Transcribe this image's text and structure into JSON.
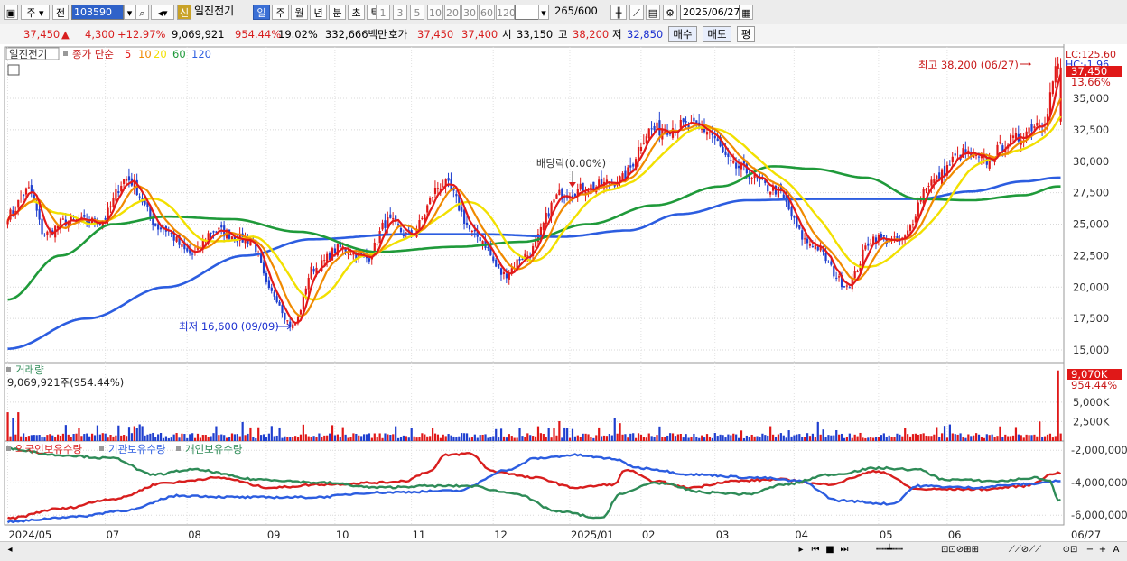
{
  "toolbar": {
    "type_label": "주",
    "market_label": "전",
    "stock_code": "103590",
    "new_badge": "신",
    "stock_name": "일진전기",
    "periods": [
      "일",
      "주",
      "월",
      "년",
      "분",
      "초",
      "틱"
    ],
    "selected_period": "일",
    "intervals": [
      "1",
      "3",
      "5",
      "10",
      "20",
      "30",
      "60",
      "120"
    ],
    "count": "265",
    "count_total": "/600",
    "date": "2025/06/27"
  },
  "info": {
    "price": "37,450",
    "change": "4,300",
    "change_pct": "+12.97%",
    "volume": "9,069,921",
    "volume_ratio": "954.44%",
    "turnover": "19.02%",
    "amount": "332,666백만",
    "ask_label": "호가",
    "ask": "37,450",
    "bid": "37,400",
    "open_label": "시",
    "open": "33,150",
    "high_label": "고",
    "high": "38,200",
    "low_label": "저",
    "low": "32,850",
    "buy_label": "매수",
    "sell_label": "매도",
    "eval_label": "평"
  },
  "legend": {
    "name": "일진전기",
    "ma_text": "종가 단순",
    "ma_periods": [
      "5",
      "10",
      "20",
      "60",
      "120"
    ],
    "ma_colors": [
      "#e31a1a",
      "#f08a00",
      "#f2e000",
      "#1f9a3a",
      "#2c5de0"
    ],
    "volume_label": "거래량",
    "volume_value": "9,069,921주(954.44%)",
    "holdings": [
      "외국인보유수량",
      "기관보유수량",
      "개인보유수량"
    ],
    "holdings_colors": [
      "#d81e1e",
      "#2c5de0",
      "#2e8b57"
    ]
  },
  "annotations": {
    "high_note": "최고 38,200 (06/27)",
    "low_note": "최저 16,600 (09/09)",
    "dividend_note": "배당락(0.00%)",
    "lc": "LC:125.60",
    "hc": "HC:-1.96",
    "price_tag": "37,450",
    "pct_tag": "13.66%",
    "vol_tag": "9,070K",
    "vol_pct_tag": "954.44%"
  },
  "chart_data": {
    "type": "line",
    "price_axis": {
      "ticks": [
        "35,000",
        "32,500",
        "30,000",
        "27,500",
        "25,000",
        "22,500",
        "20,000",
        "17,500",
        "15,000"
      ],
      "ylim": [
        14000,
        38800
      ]
    },
    "volume_axis": {
      "ticks": [
        "5,000K",
        "2,500K"
      ],
      "ylim": [
        0,
        9500
      ]
    },
    "holding_axis": {
      "ticks": [
        "-2,000,000",
        "-4,000,000",
        "-6,000,000"
      ],
      "ylim": [
        -6600000,
        -1600000
      ]
    },
    "x_labels": [
      "2024/05",
      "07",
      "08",
      "09",
      "10",
      "11",
      "12",
      "2025/01",
      "02",
      "03",
      "04",
      "05",
      "06",
      "06/27"
    ],
    "x_label_positions": [
      0,
      37,
      68,
      98,
      124,
      153,
      184,
      213,
      240,
      268,
      298,
      330,
      356,
      392
    ],
    "n": 400,
    "close_key": [
      [
        0,
        25700
      ],
      [
        8,
        27700
      ],
      [
        14,
        24200
      ],
      [
        22,
        25200
      ],
      [
        35,
        25200
      ],
      [
        45,
        28600
      ],
      [
        58,
        24700
      ],
      [
        70,
        22600
      ],
      [
        78,
        24500
      ],
      [
        92,
        23700
      ],
      [
        100,
        19500
      ],
      [
        108,
        16900
      ],
      [
        116,
        21500
      ],
      [
        126,
        23100
      ],
      [
        136,
        22300
      ],
      [
        144,
        25200
      ],
      [
        152,
        24100
      ],
      [
        165,
        28200
      ],
      [
        178,
        24000
      ],
      [
        188,
        21000
      ],
      [
        196,
        22500
      ],
      [
        210,
        27400
      ],
      [
        222,
        28000
      ],
      [
        232,
        28500
      ],
      [
        244,
        32500
      ],
      [
        256,
        32800
      ],
      [
        264,
        32500
      ],
      [
        276,
        29500
      ],
      [
        290,
        27800
      ],
      [
        304,
        23500
      ],
      [
        318,
        20200
      ],
      [
        328,
        23900
      ],
      [
        338,
        23600
      ],
      [
        350,
        28400
      ],
      [
        362,
        30600
      ],
      [
        370,
        30000
      ],
      [
        380,
        31600
      ],
      [
        392,
        33200
      ],
      [
        398,
        37450
      ]
    ],
    "ma60_key": [
      [
        0,
        19000
      ],
      [
        20,
        22500
      ],
      [
        40,
        25000
      ],
      [
        60,
        25600
      ],
      [
        85,
        25400
      ],
      [
        110,
        24400
      ],
      [
        140,
        22800
      ],
      [
        170,
        23200
      ],
      [
        195,
        23600
      ],
      [
        220,
        25000
      ],
      [
        245,
        26500
      ],
      [
        270,
        28000
      ],
      [
        290,
        29600
      ],
      [
        305,
        29400
      ],
      [
        325,
        28700
      ],
      [
        345,
        27000
      ],
      [
        365,
        26900
      ],
      [
        385,
        27300
      ],
      [
        398,
        28000
      ]
    ],
    "ma120_key": [
      [
        0,
        15100
      ],
      [
        30,
        17500
      ],
      [
        60,
        20000
      ],
      [
        90,
        22500
      ],
      [
        115,
        23800
      ],
      [
        150,
        24200
      ],
      [
        180,
        24200
      ],
      [
        210,
        24000
      ],
      [
        235,
        24500
      ],
      [
        255,
        25800
      ],
      [
        280,
        26900
      ],
      [
        305,
        27000
      ],
      [
        325,
        27000
      ],
      [
        345,
        27000
      ],
      [
        365,
        27600
      ],
      [
        385,
        28400
      ],
      [
        398,
        28700
      ]
    ],
    "dividend_index": 214,
    "volume_spikes": [
      [
        0,
        3700
      ],
      [
        2,
        3000
      ],
      [
        4,
        3700
      ],
      [
        42,
        2000
      ],
      [
        147,
        1900
      ],
      [
        205,
        1700
      ],
      [
        230,
        2900
      ],
      [
        232,
        2300
      ],
      [
        340,
        1700
      ],
      [
        352,
        1800
      ],
      [
        382,
        1800
      ],
      [
        398,
        9070
      ]
    ],
    "foreign_key": [
      [
        0,
        -6200000
      ],
      [
        20,
        -5600000
      ],
      [
        40,
        -5000000
      ],
      [
        60,
        -4000000
      ],
      [
        80,
        -3700000
      ],
      [
        100,
        -4300000
      ],
      [
        120,
        -4100000
      ],
      [
        140,
        -4000000
      ],
      [
        150,
        -3900000
      ],
      [
        160,
        -3300000
      ],
      [
        166,
        -2300000
      ],
      [
        175,
        -2200000
      ],
      [
        184,
        -3300000
      ],
      [
        200,
        -3700000
      ],
      [
        215,
        -4300000
      ],
      [
        230,
        -4100000
      ],
      [
        234,
        -3200000
      ],
      [
        245,
        -3900000
      ],
      [
        258,
        -4300000
      ],
      [
        275,
        -3900000
      ],
      [
        292,
        -3800000
      ],
      [
        310,
        -4100000
      ],
      [
        330,
        -3300000
      ],
      [
        345,
        -4400000
      ],
      [
        370,
        -4400000
      ],
      [
        385,
        -4200000
      ],
      [
        398,
        -3400000
      ]
    ],
    "institution_key": [
      [
        0,
        -6400000
      ],
      [
        25,
        -6100000
      ],
      [
        45,
        -5700000
      ],
      [
        65,
        -4800000
      ],
      [
        90,
        -4900000
      ],
      [
        115,
        -4900000
      ],
      [
        140,
        -4600000
      ],
      [
        170,
        -4500000
      ],
      [
        190,
        -3200000
      ],
      [
        200,
        -2500000
      ],
      [
        215,
        -2300000
      ],
      [
        228,
        -2500000
      ],
      [
        240,
        -3100000
      ],
      [
        260,
        -3500000
      ],
      [
        285,
        -3700000
      ],
      [
        300,
        -3900000
      ],
      [
        315,
        -5100000
      ],
      [
        335,
        -5300000
      ],
      [
        345,
        -4200000
      ],
      [
        365,
        -4300000
      ],
      [
        385,
        -4100000
      ],
      [
        398,
        -3900000
      ]
    ],
    "individual_key": [
      [
        0,
        -1900000
      ],
      [
        20,
        -2300000
      ],
      [
        40,
        -2500000
      ],
      [
        55,
        -3500000
      ],
      [
        70,
        -3200000
      ],
      [
        95,
        -3800000
      ],
      [
        120,
        -4000000
      ],
      [
        140,
        -4300000
      ],
      [
        160,
        -4200000
      ],
      [
        175,
        -4200000
      ],
      [
        190,
        -4600000
      ],
      [
        210,
        -5800000
      ],
      [
        225,
        -6200000
      ],
      [
        232,
        -4700000
      ],
      [
        245,
        -4000000
      ],
      [
        265,
        -4600000
      ],
      [
        280,
        -4700000
      ],
      [
        295,
        -4100000
      ],
      [
        312,
        -3500000
      ],
      [
        330,
        -3100000
      ],
      [
        345,
        -3200000
      ],
      [
        355,
        -3800000
      ],
      [
        375,
        -3900000
      ],
      [
        390,
        -3700000
      ],
      [
        395,
        -3900000
      ],
      [
        398,
        -5100000
      ]
    ]
  }
}
